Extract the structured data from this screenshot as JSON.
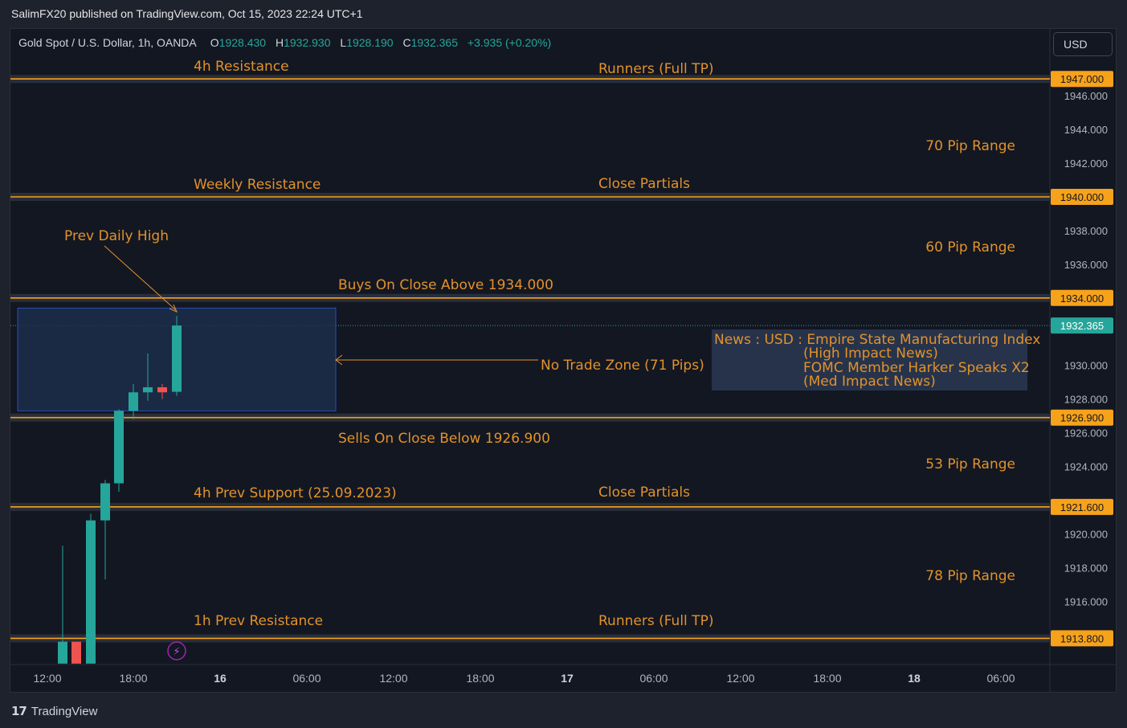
{
  "attribution": "SalimFX20 published on TradingView.com, Oct 15, 2023 22:24 UTC+1",
  "currency_button": "USD",
  "footer": {
    "brand": "TradingView"
  },
  "legend": {
    "symbol": "Gold Spot / U.S. Dollar, 1h, OANDA",
    "open_label": "O",
    "open": "1928.430",
    "high_label": "H",
    "high": "1932.930",
    "low_label": "L",
    "low": "1928.190",
    "close_label": "C",
    "close": "1932.365",
    "change": "+3.935 (+0.20%)"
  },
  "colors": {
    "up": "#26a69a",
    "down": "#ef5350",
    "level_line": "#f7a21b",
    "annotation": "#e2922a",
    "zone_fill": "#1c2e4a",
    "zone_border": "#2962ff",
    "background": "#131722"
  },
  "chart_data": {
    "type": "candlestick",
    "symbol": "XAUUSD",
    "timeframe": "1h",
    "x_ticks": [
      "12:00",
      "18:00",
      "16",
      "06:00",
      "12:00",
      "18:00",
      "17",
      "06:00",
      "12:00",
      "18:00",
      "18",
      "06:00"
    ],
    "y_ticks": [
      "1946.000",
      "1944.000",
      "1942.000",
      "1938.000",
      "1936.000",
      "1930.000",
      "1928.000",
      "1926.000",
      "1924.000",
      "1920.000",
      "1918.000",
      "1916.000"
    ],
    "ylim": [
      1912.3,
      1948.2
    ],
    "candles": [
      {
        "o": 1913.6,
        "h": 1919.3,
        "l": 1912.3,
        "c": 1912.3
      },
      {
        "o": 1913.6,
        "h": 1913.6,
        "l": 1912.3,
        "c": 1912.3
      },
      {
        "o": 1912.3,
        "h": 1921.2,
        "l": 1912.3,
        "c": 1920.8
      },
      {
        "o": 1920.8,
        "h": 1923.2,
        "l": 1917.3,
        "c": 1923.0
      },
      {
        "o": 1923.0,
        "h": 1927.4,
        "l": 1922.5,
        "c": 1927.3
      },
      {
        "o": 1927.3,
        "h": 1928.9,
        "l": 1926.8,
        "c": 1928.4
      },
      {
        "o": 1928.4,
        "h": 1930.7,
        "l": 1927.9,
        "c": 1928.7
      },
      {
        "o": 1928.7,
        "h": 1928.9,
        "l": 1928.0,
        "c": 1928.4
      },
      {
        "o": 1928.43,
        "h": 1932.93,
        "l": 1928.19,
        "c": 1932.365
      }
    ],
    "levels": [
      {
        "price": 1947.0,
        "label": "1947.000",
        "left_text": "4h Resistance",
        "right_text": "Runners (Full TP)"
      },
      {
        "price": 1940.0,
        "label": "1940.000",
        "left_text": "Weekly Resistance",
        "right_text": "Close Partials"
      },
      {
        "price": 1934.0,
        "label": "1934.000",
        "left_text": "Buys On Close Above 1934.000",
        "right_text": ""
      },
      {
        "price": 1926.9,
        "label": "1926.900",
        "left_text": "Sells On Close Below 1926.900",
        "right_text": ""
      },
      {
        "price": 1921.6,
        "label": "1921.600",
        "left_text": "4h Prev Support (25.09.2023)",
        "right_text": "Close Partials"
      },
      {
        "price": 1913.8,
        "label": "1913.800",
        "left_text": "1h Prev Resistance",
        "right_text": "Runners (Full TP)"
      }
    ],
    "current_price": {
      "value": 1932.365,
      "label": "1932.365"
    },
    "ranges": [
      "70 Pip Range",
      "60 Pip Range",
      "53 Pip Range",
      "78 Pip Range"
    ],
    "zone": {
      "from": 1927.3,
      "to": 1933.4,
      "label": "No Trade Zone (71 Pips)"
    },
    "prev_daily_high": {
      "price": 1933.4,
      "label": "Prev Daily High"
    },
    "news": [
      "News : USD : Empire State Manufacturing Index",
      "(High Impact News)",
      "FOMC Member Harker Speaks X2",
      "(Med Impact News)"
    ]
  }
}
